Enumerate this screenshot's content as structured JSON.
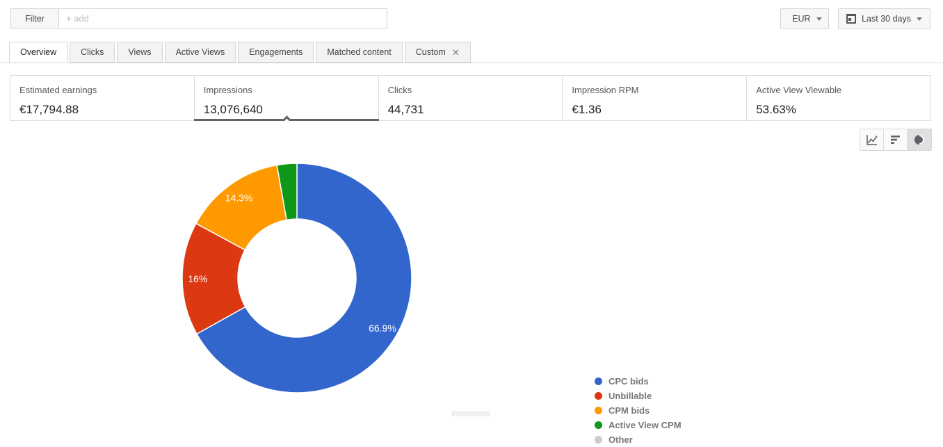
{
  "toolbar": {
    "filter_button_label": "Filter",
    "filter_placeholder": "+ add",
    "filter_value": "",
    "currency_label": "EUR",
    "date_range_label": "Last 30 days"
  },
  "tabs": [
    {
      "label": "Overview",
      "active": true,
      "closable": false
    },
    {
      "label": "Clicks",
      "active": false,
      "closable": false
    },
    {
      "label": "Views",
      "active": false,
      "closable": false
    },
    {
      "label": "Active Views",
      "active": false,
      "closable": false
    },
    {
      "label": "Engagements",
      "active": false,
      "closable": false
    },
    {
      "label": "Matched content",
      "active": false,
      "closable": false
    },
    {
      "label": "Custom",
      "active": false,
      "closable": true,
      "close_glyph": "✕"
    }
  ],
  "cards": [
    {
      "label": "Estimated earnings",
      "value": "€17,794.88",
      "selected": false
    },
    {
      "label": "Impressions",
      "value": "13,076,640",
      "selected": true
    },
    {
      "label": "Clicks",
      "value": "44,731",
      "selected": false
    },
    {
      "label": "Impression RPM",
      "value": "€1.36",
      "selected": false
    },
    {
      "label": "Active View Viewable",
      "value": "53.63%",
      "selected": false
    }
  ],
  "chart_toggles": [
    {
      "icon": "line-chart-icon",
      "active": false
    },
    {
      "icon": "bar-chart-icon",
      "active": false
    },
    {
      "icon": "pie-chart-icon",
      "active": true
    }
  ],
  "chart_data": {
    "type": "pie",
    "variant": "donut",
    "title": "",
    "metric": "Impressions",
    "categories": [
      "CPC bids",
      "Unbillable",
      "CPM bids",
      "Active View CPM",
      "Other"
    ],
    "values": [
      66.9,
      16,
      14.3,
      2.8,
      0
    ],
    "unit": "%",
    "data_labels": [
      "66.9%",
      "16%",
      "14.3%",
      "",
      ""
    ],
    "colors": [
      "#3366cc",
      "#dc3912",
      "#ff9900",
      "#109618",
      "#cccccc"
    ],
    "start_angle_deg": 0,
    "direction": "clockwise",
    "inner_radius_ratio": 0.515,
    "legend_position": "right",
    "legend": [
      {
        "label": "CPC bids",
        "color": "#3366cc"
      },
      {
        "label": "Unbillable",
        "color": "#dc3912"
      },
      {
        "label": "CPM bids",
        "color": "#ff9900"
      },
      {
        "label": "Active View CPM",
        "color": "#109618"
      },
      {
        "label": "Other",
        "color": "#cccccc"
      }
    ]
  }
}
